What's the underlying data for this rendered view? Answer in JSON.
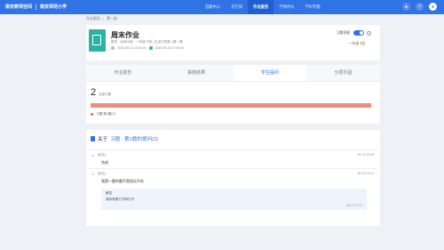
{
  "header": {
    "brand": "南京教师空间",
    "school": "南京师范小学",
    "nav": [
      "答题中心",
      "云空间",
      "作业报告",
      "学情评价",
      "学科专题"
    ],
    "active_nav": "作业报告",
    "icons": [
      "user-avatar-icon",
      "help-icon",
      "account-icon"
    ]
  },
  "breadcrumb": [
    "作业报告",
    "第一部"
  ],
  "homework": {
    "title": "周末作业",
    "meta": "数学 · 北师大版 · 一年级下册  |  生活中的数  |  第一课",
    "time_start": "2020-05-13 16:00:00",
    "time_end": "2020-05-18 17:00:00",
    "auto_label": "习题答案:",
    "submitted": "一年级 3班"
  },
  "tabs": [
    "作业报告",
    "答题结果",
    "学生提问",
    "分层巩固"
  ],
  "active_tab": "学生提问",
  "stats": {
    "count": "2",
    "count_label": "全部问题",
    "legend": "习题  第1题(2)",
    "bar_fill_fraction": 1.0
  },
  "qa": {
    "prefix": "关于",
    "link": "习题 : 第1题的提问(2)",
    "items": [
      {
        "user": "(姓名)",
        "time": "05-15 20:08",
        "text": "完成"
      },
      {
        "user": "(姓名)",
        "time": "05-15 20:11",
        "text": "我第一题的题不是很远不吃"
      }
    ],
    "reply": {
      "label": "解答",
      "text": "请你再看打开和打开",
      "time": "05-15 17:57"
    }
  },
  "colors": {
    "primary": "#2f73e5",
    "progress": "#ef8f7b",
    "cover": "#2bb4a4"
  }
}
